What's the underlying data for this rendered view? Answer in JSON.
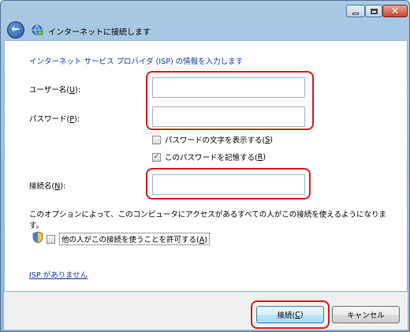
{
  "window": {
    "title": "インターネットに接続します",
    "controls": {
      "minimize_icon": "minimize-icon",
      "maximize_icon": "maximize-icon",
      "close_icon": "close-icon"
    }
  },
  "nav": {
    "back_icon": "back-arrow-icon",
    "app_icon": "network-connection-icon"
  },
  "main": {
    "heading": "インターネット サービス プロバイダ (ISP) の情報を入力します",
    "username": {
      "label_prefix": "ユーザー名(",
      "label_key": "U",
      "label_suffix": "):",
      "value": ""
    },
    "password": {
      "label_prefix": "パスワード(",
      "label_key": "P",
      "label_suffix": "):",
      "value": ""
    },
    "show_password": {
      "label_prefix": "パスワードの文字を表示する(",
      "label_key": "S",
      "label_suffix": ")",
      "checked": false
    },
    "remember_password": {
      "label_prefix": "このパスワードを記憶する(",
      "label_key": "R",
      "label_suffix": ")",
      "checked": true
    },
    "connection_name": {
      "label_prefix": "接続名(",
      "label_key": "N",
      "label_suffix": "):",
      "value": ""
    },
    "description": "このオプションによって、このコンピュータにアクセスがあるすべての人がこの接続を使えるようになります。",
    "allow_others": {
      "label_prefix": "他の人がこの接続を使うことを許可する(",
      "label_key": "A",
      "label_suffix": ")",
      "checked": false,
      "icon": "uac-shield-icon"
    },
    "no_isp_link": "ISP がありません"
  },
  "footer": {
    "connect": {
      "prefix": "接続(",
      "key": "C",
      "suffix": ")"
    },
    "cancel": "キャンセル"
  },
  "colors": {
    "highlight": "#d81e1e",
    "link": "#1a3d9c",
    "heading": "#1a3d9c"
  }
}
